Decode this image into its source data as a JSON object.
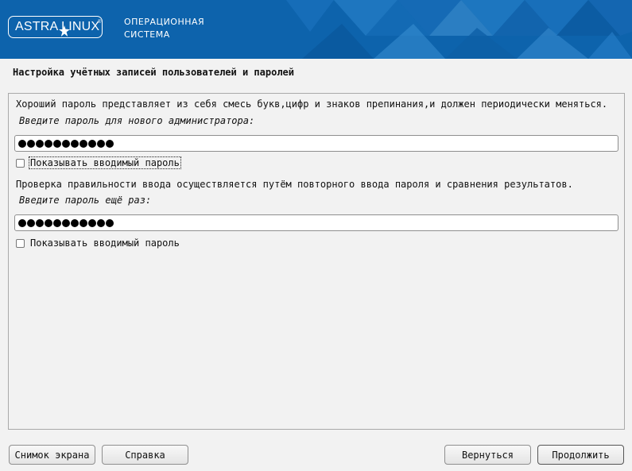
{
  "header": {
    "logo_text": "ASTRA LINUX",
    "logo_registered": "®",
    "tagline_line1": "ОПЕРАЦИОННАЯ",
    "tagline_line2": "СИСТЕМА",
    "brand_color": "#0d63ac"
  },
  "page": {
    "title": "Настройка учётных записей пользователей и паролей"
  },
  "form": {
    "hint_text": "Хороший пароль представляет из себя смесь букв,цифр и знаков препинания,и должен периодически меняться.",
    "password_prompt": "Введите пароль для нового администратора:",
    "password_dot_count": 11,
    "show_password_label": "Показывать вводимый пароль",
    "show_password_checked": false,
    "verify_hint_text": "Проверка правильности ввода осуществляется путём повторного ввода пароля и сравнения результатов.",
    "verify_prompt": "Введите пароль ещё раз:",
    "verify_dot_count": 11,
    "show_verify_label": "Показывать вводимый пароль",
    "show_verify_checked": false
  },
  "footer": {
    "screenshot_label": "Снимок экрана",
    "help_label": "Справка",
    "back_label": "Вернуться",
    "continue_label": "Продолжить"
  }
}
